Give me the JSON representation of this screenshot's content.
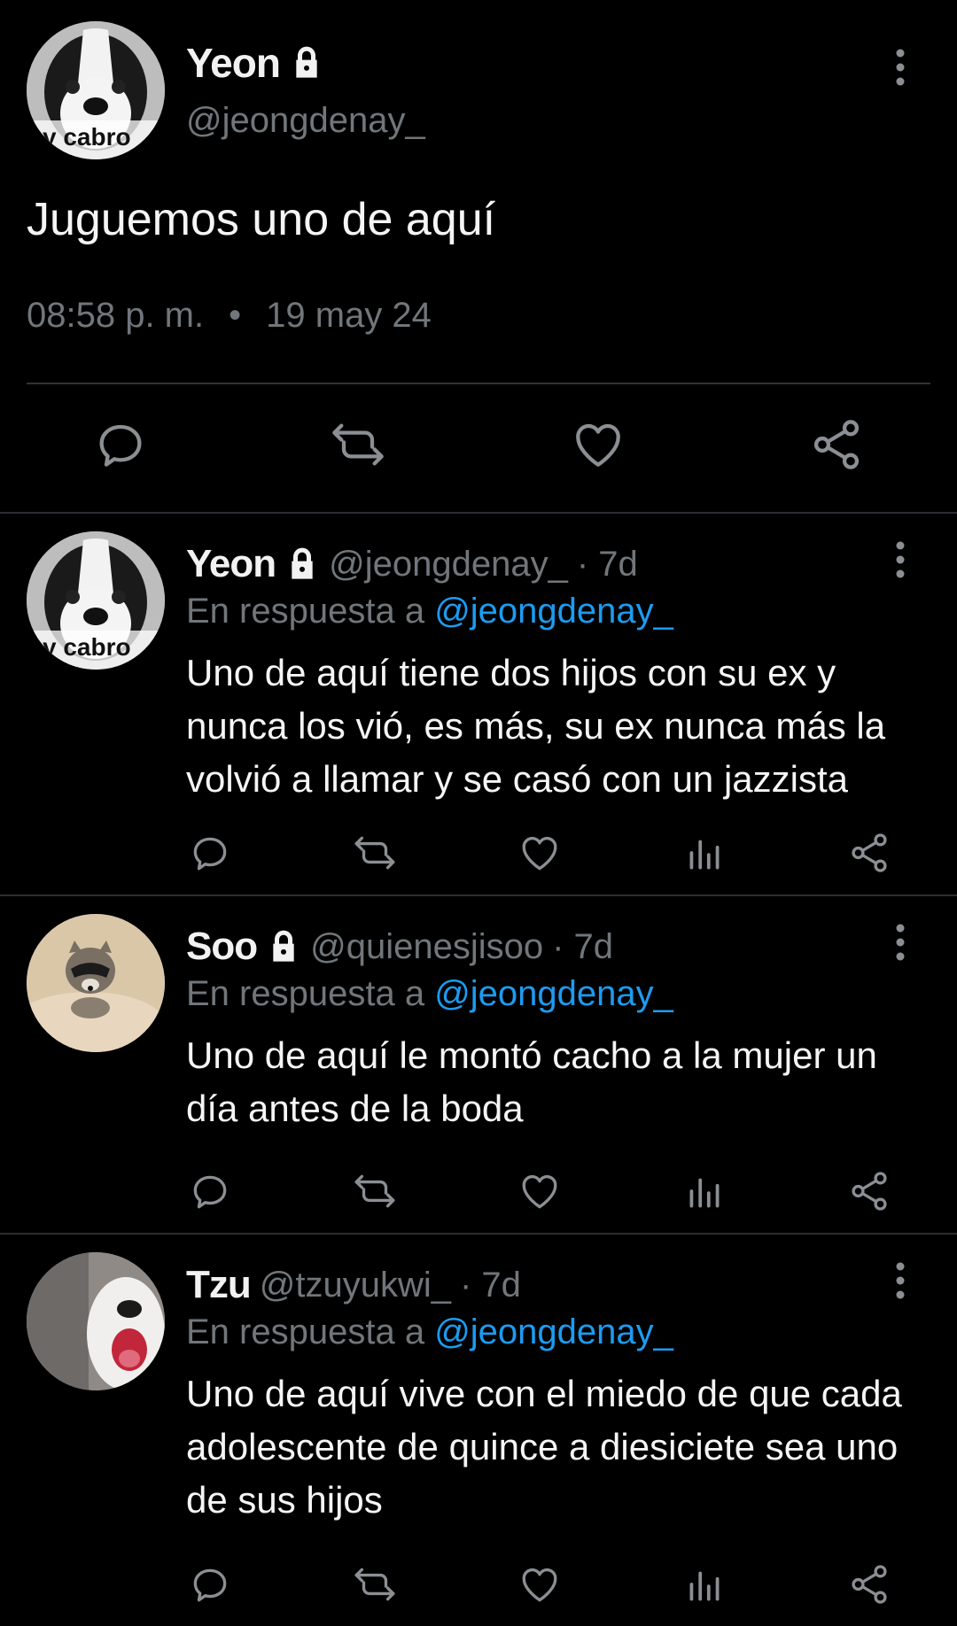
{
  "main_tweet": {
    "name": "Yeon",
    "handle": "@jeongdenay_",
    "avatar_caption": "y cabro",
    "text": "Juguemos uno de aquí",
    "time": "08:58 p. m.",
    "separator": "•",
    "date": "19 may 24",
    "icons": {
      "lock": "lock-icon",
      "more": "more-vertical-icon",
      "reply": "reply-icon",
      "retweet": "retweet-icon",
      "like": "heart-icon",
      "share": "share-icon"
    }
  },
  "replies": [
    {
      "name": "Yeon",
      "locked": true,
      "handle": "@jeongdenay_",
      "time": "· 7d",
      "reply_prefix": "En respuesta a",
      "reply_to": "@jeongdenay_",
      "avatar_caption": "y cabro",
      "text": "Uno de aquí tiene dos hijos con su ex y nunca los vió, es más, su ex nunca más la volvió a llamar y se casó con un jazzista"
    },
    {
      "name": "Soo",
      "locked": true,
      "handle": "@quienesjisoo",
      "time": "· 7d",
      "reply_prefix": "En respuesta a",
      "reply_to": "@jeongdenay_",
      "text": "Uno de aquí le montó cacho a la mujer un día antes de la boda"
    },
    {
      "name": "Tzu",
      "locked": false,
      "handle": "@tzuyukwi_",
      "time": "· 7d",
      "reply_prefix": "En respuesta a",
      "reply_to": "@jeongdenay_",
      "text": "Uno de aquí vive con el miedo de que cada adolescente de quince a diesiciete sea uno de sus hijos"
    }
  ],
  "colors": {
    "background": "#000000",
    "text_primary": "#f5f5f5",
    "text_secondary": "#71767b",
    "link": "#1d9bf0",
    "divider": "#2f3336"
  }
}
